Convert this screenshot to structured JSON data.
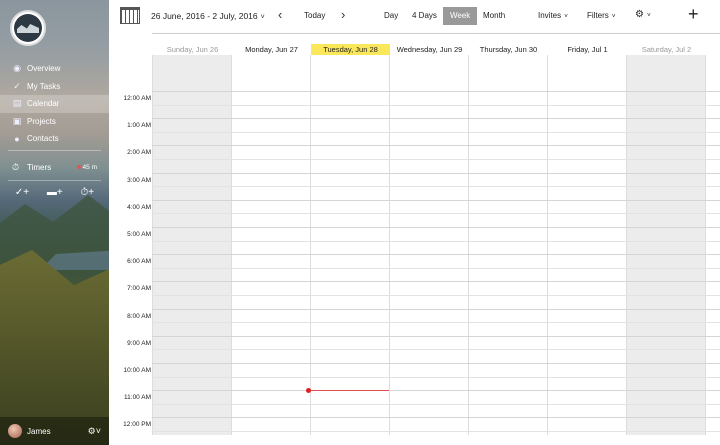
{
  "sidebar": {
    "nav": [
      {
        "label": "Overview",
        "icon": "eye-icon"
      },
      {
        "label": "My Tasks",
        "icon": "check-icon"
      },
      {
        "label": "Calendar",
        "icon": "calendar-icon",
        "active": true
      },
      {
        "label": "Projects",
        "icon": "folder-icon"
      },
      {
        "label": "Contacts",
        "icon": "person-icon"
      }
    ],
    "timers": {
      "label": "Timers",
      "value": "45 m"
    },
    "user": {
      "name": "James"
    }
  },
  "toolbar": {
    "range": "26 June, 2016 - 2 July, 2016",
    "today": "Today",
    "views": [
      "Day",
      "4 Days",
      "Week",
      "Month"
    ],
    "active_view": "Week",
    "invites": "Invites",
    "filters": "Filters"
  },
  "calendar": {
    "days": [
      {
        "label": "Sunday, Jun 26",
        "weekend": true
      },
      {
        "label": "Monday, Jun 27"
      },
      {
        "label": "Tuesday, Jun 28",
        "today": true
      },
      {
        "label": "Wednesday, Jun 29"
      },
      {
        "label": "Thursday, Jun 30"
      },
      {
        "label": "Friday, Jul 1"
      },
      {
        "label": "Saturday, Jul 2",
        "weekend": true
      }
    ],
    "times": [
      "12:00 AM",
      "1:00 AM",
      "2:00 AM",
      "3:00 AM",
      "4:00 AM",
      "5:00 AM",
      "6:00 AM",
      "7:00 AM",
      "8:00 AM",
      "9:00 AM",
      "10:00 AM",
      "11:00 AM",
      "12:00 PM"
    ],
    "accent_today": "#fbe75a",
    "now_indicator_color": "#e02020"
  }
}
